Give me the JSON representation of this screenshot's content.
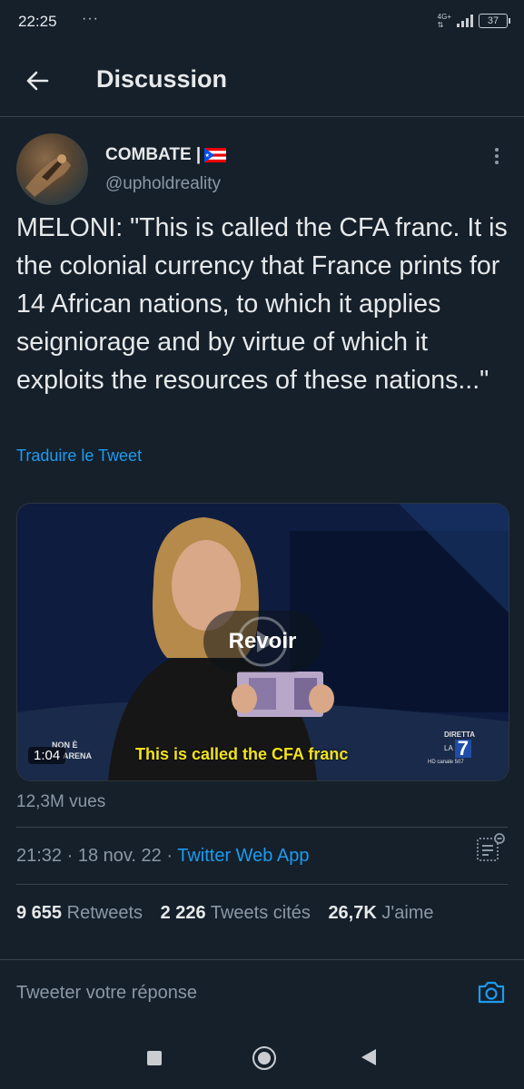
{
  "status_bar": {
    "time": "22:25",
    "dots": "···",
    "network": "4G+",
    "network_sub": "⇅",
    "battery": "37"
  },
  "header": {
    "title": "Discussion",
    "back_icon": "arrow-left-icon"
  },
  "tweet": {
    "display_name": "COMBATE |",
    "flag": "puerto-rico-flag",
    "username": "@upholdreality",
    "text": "MELONI: \"This is called the CFA franc. It is the colonial currency that France prints for 14 African nations, to which it applies seigniorage and by virtue of which it exploits the resources of these nations...\"",
    "translate_label": "Traduire le Tweet",
    "media": {
      "replay_label": "Revoir",
      "duration": "1:04",
      "subtitle": "This is called the CFA franc",
      "logo_left_top": "NON È",
      "logo_left_bottom": "ARENA",
      "logo_right_top": "DIRETTA",
      "logo_right_mid": "LA",
      "logo_right_num": "7",
      "logo_right_bottom": "HD canale 507"
    },
    "views": "12,3M vues",
    "time": "21:32",
    "separator1": " · ",
    "date": "18 nov. 22",
    "separator2": " · ",
    "source_app": "Twitter Web App",
    "stats": {
      "retweets_count": "9 655",
      "retweets_label": "Retweets",
      "quotes_count": "2 226",
      "quotes_label": "Tweets cités",
      "likes_count": "26,7K",
      "likes_label": "J'aime"
    }
  },
  "reply": {
    "placeholder": "Tweeter votre réponse",
    "camera_icon": "camera-icon"
  },
  "colors": {
    "background": "#15202b",
    "accent": "#1d9bf0",
    "secondary_text": "#8b98a5",
    "divider": "#38444d",
    "subtitle": "#f2e21c"
  }
}
